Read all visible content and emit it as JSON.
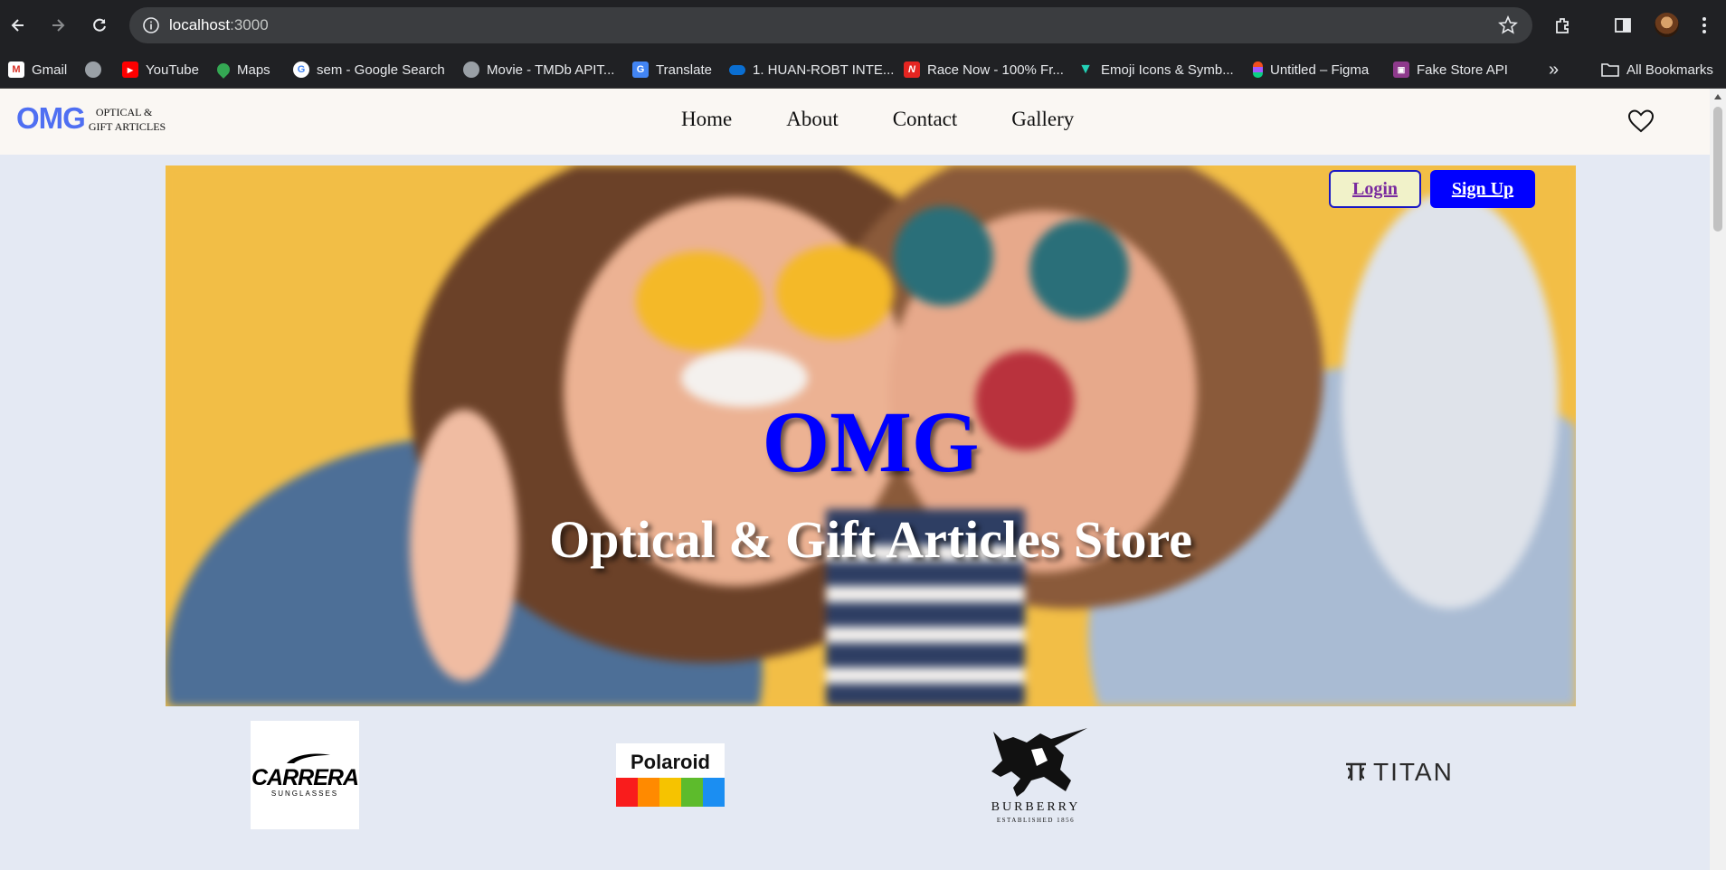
{
  "browser": {
    "url_host": "localhost",
    "url_port": ":3000",
    "bookmarks": [
      {
        "label": "Gmail",
        "icon": "gmail-icon"
      },
      {
        "label": "",
        "icon": "globe-icon"
      },
      {
        "label": "YouTube",
        "icon": "youtube-icon"
      },
      {
        "label": "Maps",
        "icon": "maps-icon"
      },
      {
        "label": "sem - Google Search",
        "icon": "google-icon"
      },
      {
        "label": "Movie - TMDb APIT...",
        "icon": "globe-icon"
      },
      {
        "label": "Translate",
        "icon": "translate-icon"
      },
      {
        "label": "1. HUAN-ROBT INTE...",
        "icon": "onedrive-icon"
      },
      {
        "label": "Race Now - 100% Fr...",
        "icon": "race-icon"
      },
      {
        "label": "Emoji Icons & Symb...",
        "icon": "emoji-icon"
      },
      {
        "label": "Untitled – Figma",
        "icon": "figma-icon"
      },
      {
        "label": "Fake Store API",
        "icon": "store-icon"
      }
    ],
    "all_bookmarks": "All Bookmarks",
    "overflow": "»"
  },
  "site": {
    "logo_mark": "OMG",
    "logo_line1": "OPTICAL &",
    "logo_line2": "GIFT ARTICLES",
    "nav": [
      "Home",
      "About",
      "Contact",
      "Gallery"
    ]
  },
  "hero": {
    "title": "OMG",
    "subtitle": "Optical & Gift Articles Store",
    "login": "Login",
    "signup": "Sign Up"
  },
  "brands": {
    "carrera": {
      "name": "CARRERA",
      "tag": "SUNGLASSES"
    },
    "polaroid": {
      "name": "Polaroid",
      "colors": [
        "#f91c1c",
        "#ff8a00",
        "#f6c300",
        "#5dbb2c",
        "#1b8ef2"
      ]
    },
    "burberry": {
      "name": "BURBERRY",
      "tag": "ESTABLISHED 1856"
    },
    "titan": {
      "name": "TITAN"
    }
  }
}
